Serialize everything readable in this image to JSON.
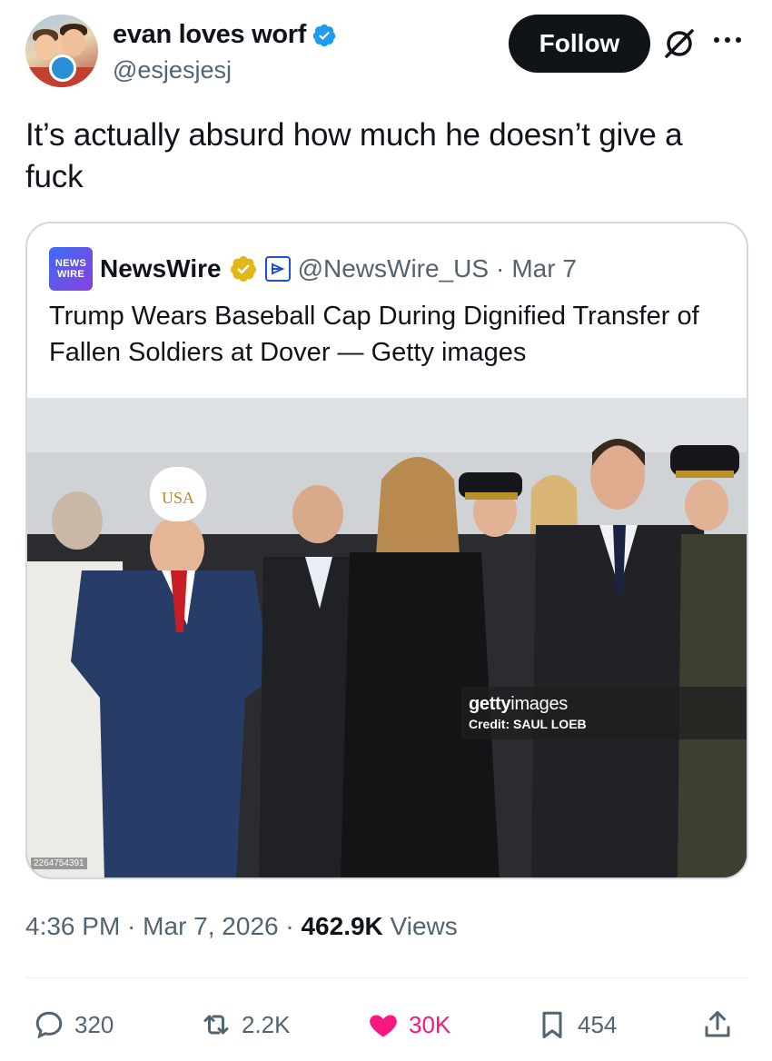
{
  "author": {
    "display_name": "evan loves worf",
    "handle": "@esjesjesj",
    "verified": true
  },
  "follow_button": "Follow",
  "icons": {
    "verified": "verified-badge-icon",
    "grok": "grok-icon",
    "more": "more-options-icon"
  },
  "tweet": {
    "text": "It’s actually absurd how much he doesn’t give a fuck"
  },
  "quote": {
    "logo_line1": "NEWS",
    "logo_line2": "WIRE",
    "name": "NewsWire",
    "handle": "@NewsWire_US",
    "separator": "·",
    "date": "Mar 7",
    "text": "Trump Wears Baseball Cap During Dignified Transfer of Fallen Soldiers at Dover — Getty images",
    "image": {
      "watermark_brand_bold": "getty",
      "watermark_brand_light": "images",
      "watermark_credit": "Credit: SAUL LOEB",
      "image_id": "2264754391",
      "cap_text": "USA"
    }
  },
  "meta": {
    "time": "4:36 PM",
    "sep1": " · ",
    "date": "Mar 7, 2026",
    "sep2": " · ",
    "views": "462.9K",
    "views_label": " Views"
  },
  "actions": {
    "replies": "320",
    "reposts": "2.2K",
    "likes": "30K",
    "bookmarks": "454"
  },
  "colors": {
    "follow_bg": "#0f1419",
    "verified_blue": "#1d9bf0",
    "verified_gold": "#e2b719",
    "like_pink": "#f91880",
    "secondary_text": "#536471"
  }
}
